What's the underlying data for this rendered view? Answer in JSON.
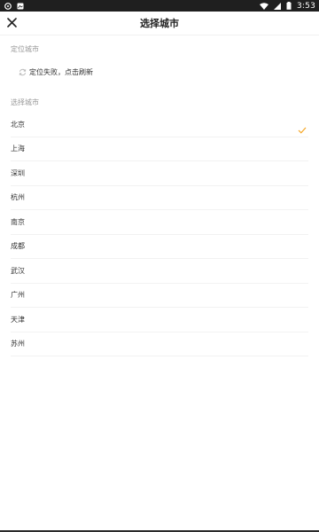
{
  "status_bar": {
    "icons_left": [
      "chat-bubble-icon",
      "image-icon"
    ],
    "icons_right": [
      "wifi-icon",
      "signal-icon",
      "battery-icon"
    ],
    "time": "3:53"
  },
  "header": {
    "title": "选择城市",
    "close_icon": "close-icon"
  },
  "location_section": {
    "label": "定位城市",
    "status_icon": "refresh-icon",
    "status_text": "定位失败，点击刷新"
  },
  "city_section": {
    "label": "选择城市",
    "cities": [
      {
        "name": "北京",
        "selected": true
      },
      {
        "name": "上海",
        "selected": false
      },
      {
        "name": "深圳",
        "selected": false
      },
      {
        "name": "杭州",
        "selected": false
      },
      {
        "name": "南京",
        "selected": false
      },
      {
        "name": "成都",
        "selected": false
      },
      {
        "name": "武汉",
        "selected": false
      },
      {
        "name": "广州",
        "selected": false
      },
      {
        "name": "天津",
        "selected": false
      },
      {
        "name": "苏州",
        "selected": false
      }
    ]
  },
  "colors": {
    "accent": "#f5a623",
    "divider": "#f2f2f2",
    "section_label": "#999999",
    "text": "#333333"
  }
}
